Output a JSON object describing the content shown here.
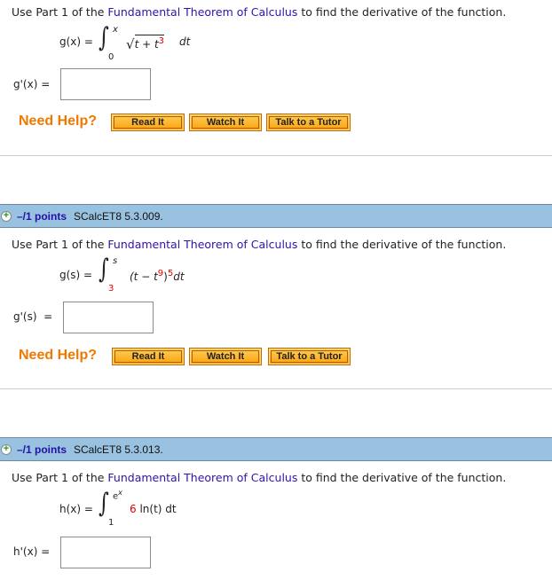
{
  "questions": [
    {
      "prompt_pre": "Use Part 1 of the ",
      "prompt_link": "Fundamental Theorem of Calculus",
      "prompt_post": " to find the derivative of the function.",
      "function_lhs": "g(x) =",
      "upper_limit": "x",
      "lower_limit": "0",
      "integrand_a": "t + t",
      "integrand_exp": "3",
      "integrand_dt": "dt",
      "answer_label": "g'(x) =",
      "answer_value": "",
      "need_help": "Need Help?",
      "buttons": [
        "Read It",
        "Watch It",
        "Talk to a Tutor"
      ]
    },
    {
      "header_points": "–/1 points",
      "header_id": "SCalcET8 5.3.009.",
      "prompt_pre": "Use Part 1 of the ",
      "prompt_link": "Fundamental Theorem of Calculus",
      "prompt_post": " to find the derivative of the function.",
      "function_lhs": "g(s) =",
      "upper_limit": "s",
      "lower_limit": "3",
      "integrand_a": "(t − t",
      "integrand_exp1": "9",
      "integrand_b": ")",
      "integrand_exp2": "5",
      "integrand_dt": "dt",
      "answer_label": "g'(s)  =",
      "answer_value": "",
      "need_help": "Need Help?",
      "buttons": [
        "Read It",
        "Watch It",
        "Talk to a Tutor"
      ]
    },
    {
      "header_points": "–/1 points",
      "header_id": "SCalcET8 5.3.013.",
      "prompt_pre": "Use Part 1 of the ",
      "prompt_link": "Fundamental Theorem of Calculus",
      "prompt_post": " to find the derivative of the function.",
      "function_lhs": "h(x) =",
      "upper_limit_base": "e",
      "upper_limit_exp": "x",
      "lower_limit": "1",
      "integrand_coef": "6",
      "integrand_a": " ln(t) dt",
      "answer_label": "h'(x) =",
      "answer_value": ""
    }
  ]
}
